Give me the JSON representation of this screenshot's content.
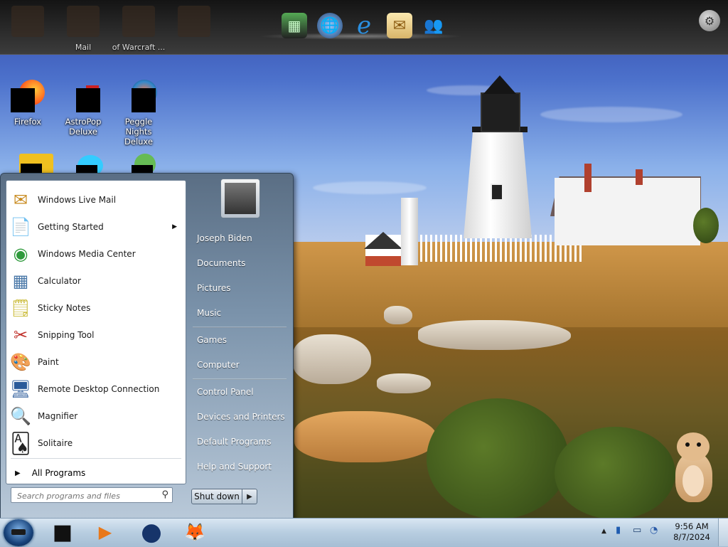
{
  "top_dock": {
    "ghost_icons": [
      {
        "name": "desktop-shortcut-1",
        "label": ""
      },
      {
        "name": "mail",
        "label": "Mail"
      },
      {
        "name": "world-of-warcraft",
        "label": "of Warcraft ..."
      },
      {
        "name": "desktop-shortcut-4",
        "label": ""
      }
    ],
    "apps": [
      {
        "name": "calculator-dock-icon",
        "glyph": "▦"
      },
      {
        "name": "internet-download-icon",
        "glyph": "🌐"
      },
      {
        "name": "internet-explorer-icon",
        "glyph": "e"
      },
      {
        "name": "mail-dock-icon",
        "glyph": "✉"
      },
      {
        "name": "messenger-people-icon",
        "glyph": "👥"
      }
    ]
  },
  "desktop_icons": [
    {
      "name": "firefox-desktop-icon",
      "label": "Firefox"
    },
    {
      "name": "astropop-desktop-icon",
      "label": "AstroPop Deluxe"
    },
    {
      "name": "peggle-desktop-icon",
      "label": "Peggle Nights Deluxe"
    }
  ],
  "start_menu": {
    "programs": [
      {
        "label": "Windows Live Mail",
        "icon": "mail-icon",
        "glyph": "✉",
        "has_submenu": false
      },
      {
        "label": "Getting Started",
        "icon": "getting-started-icon",
        "glyph": "📄",
        "has_submenu": true
      },
      {
        "label": "Windows Media Center",
        "icon": "media-center-icon",
        "glyph": "◉",
        "has_submenu": false
      },
      {
        "label": "Calculator",
        "icon": "calculator-icon",
        "glyph": "▦",
        "has_submenu": false
      },
      {
        "label": "Sticky Notes",
        "icon": "sticky-notes-icon",
        "glyph": "🗒",
        "has_submenu": false
      },
      {
        "label": "Snipping Tool",
        "icon": "scissors-icon",
        "glyph": "✂",
        "has_submenu": false
      },
      {
        "label": "Paint",
        "icon": "paint-palette-icon",
        "glyph": "🎨",
        "has_submenu": false
      },
      {
        "label": "Remote Desktop Connection",
        "icon": "remote-desktop-icon",
        "glyph": "🖥",
        "has_submenu": false
      },
      {
        "label": "Magnifier",
        "icon": "magnifier-icon",
        "glyph": "🔍",
        "has_submenu": false
      },
      {
        "label": "Solitaire",
        "icon": "cards-icon",
        "glyph": "🂡",
        "has_submenu": false
      }
    ],
    "all_programs": "All Programs",
    "search_placeholder": "Search programs and files",
    "right_links": [
      {
        "label": "Joseph Biden",
        "name": "user-name-link"
      },
      {
        "label": "Documents",
        "name": "documents-link"
      },
      {
        "label": "Pictures",
        "name": "pictures-link"
      },
      {
        "label": "Music",
        "name": "music-link"
      },
      {
        "label": "Games",
        "name": "games-link"
      },
      {
        "label": "Computer",
        "name": "computer-link"
      },
      {
        "label": "Control Panel",
        "name": "control-panel-link"
      },
      {
        "label": "Devices and Printers",
        "name": "devices-printers-link"
      },
      {
        "label": "Default Programs",
        "name": "default-programs-link"
      },
      {
        "label": "Help and Support",
        "name": "help-support-link"
      }
    ],
    "shutdown_label": "Shut down"
  },
  "taskbar": {
    "pinned": [
      {
        "name": "taskbar-app-black-icon",
        "glyph": "■"
      },
      {
        "name": "taskbar-media-player-icon",
        "glyph": "▶"
      },
      {
        "name": "taskbar-globe-icon",
        "glyph": "●"
      },
      {
        "name": "taskbar-firefox-icon",
        "glyph": "🦊"
      }
    ],
    "tray": {
      "show_hidden": "▲",
      "clock_time": "9:56 AM",
      "clock_date": "8/7/2024"
    }
  }
}
